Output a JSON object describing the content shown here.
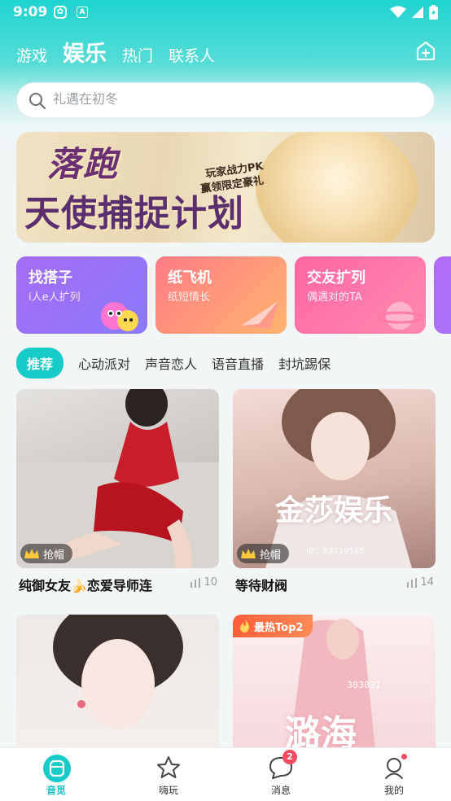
{
  "status_bar": {
    "time": "9:09"
  },
  "top_tabs": [
    {
      "label": "游戏"
    },
    {
      "label": "娱乐"
    },
    {
      "label": "热门"
    },
    {
      "label": "联系人"
    }
  ],
  "search": {
    "placeholder": "礼遇在初冬"
  },
  "banner": {
    "title_line1": "落跑",
    "title_line2": "天使捕捉计划",
    "sub_line1": "玩家战力PK",
    "sub_line2": "赢领限定豪礼"
  },
  "feature_cards": [
    {
      "title": "找搭子",
      "subtitle": "i人e人扩列"
    },
    {
      "title": "纸飞机",
      "subtitle": "纸短情长"
    },
    {
      "title": "交友扩列",
      "subtitle": "偶遇对的TA"
    },
    {
      "title": "",
      "subtitle": ""
    }
  ],
  "sub_tabs": [
    {
      "label": "推荐"
    },
    {
      "label": "心动派对"
    },
    {
      "label": "声音恋人"
    },
    {
      "label": "语音直播"
    },
    {
      "label": "封坑踢保"
    }
  ],
  "rooms": [
    {
      "name": "纯御女友🍌恋爱导师连",
      "count": "10",
      "badge": "抢帽"
    },
    {
      "name": "等待财阀",
      "count": "14",
      "badge": "抢帽",
      "photo_text": "金莎娱乐",
      "photo_id": "ID：63719595"
    },
    {
      "name": "",
      "count": "",
      "badge": ""
    },
    {
      "name": "",
      "count": "",
      "hot_badge": "最热Top2",
      "photo_text": "潞海",
      "photo_id": "383891"
    }
  ],
  "bottom_nav": [
    {
      "label": "音觅"
    },
    {
      "label": "嗨玩"
    },
    {
      "label": "消息",
      "badge": "2"
    },
    {
      "label": "我的"
    }
  ],
  "colors": {
    "accent": "#17ccc8",
    "badge_red": "#f44b5f"
  }
}
